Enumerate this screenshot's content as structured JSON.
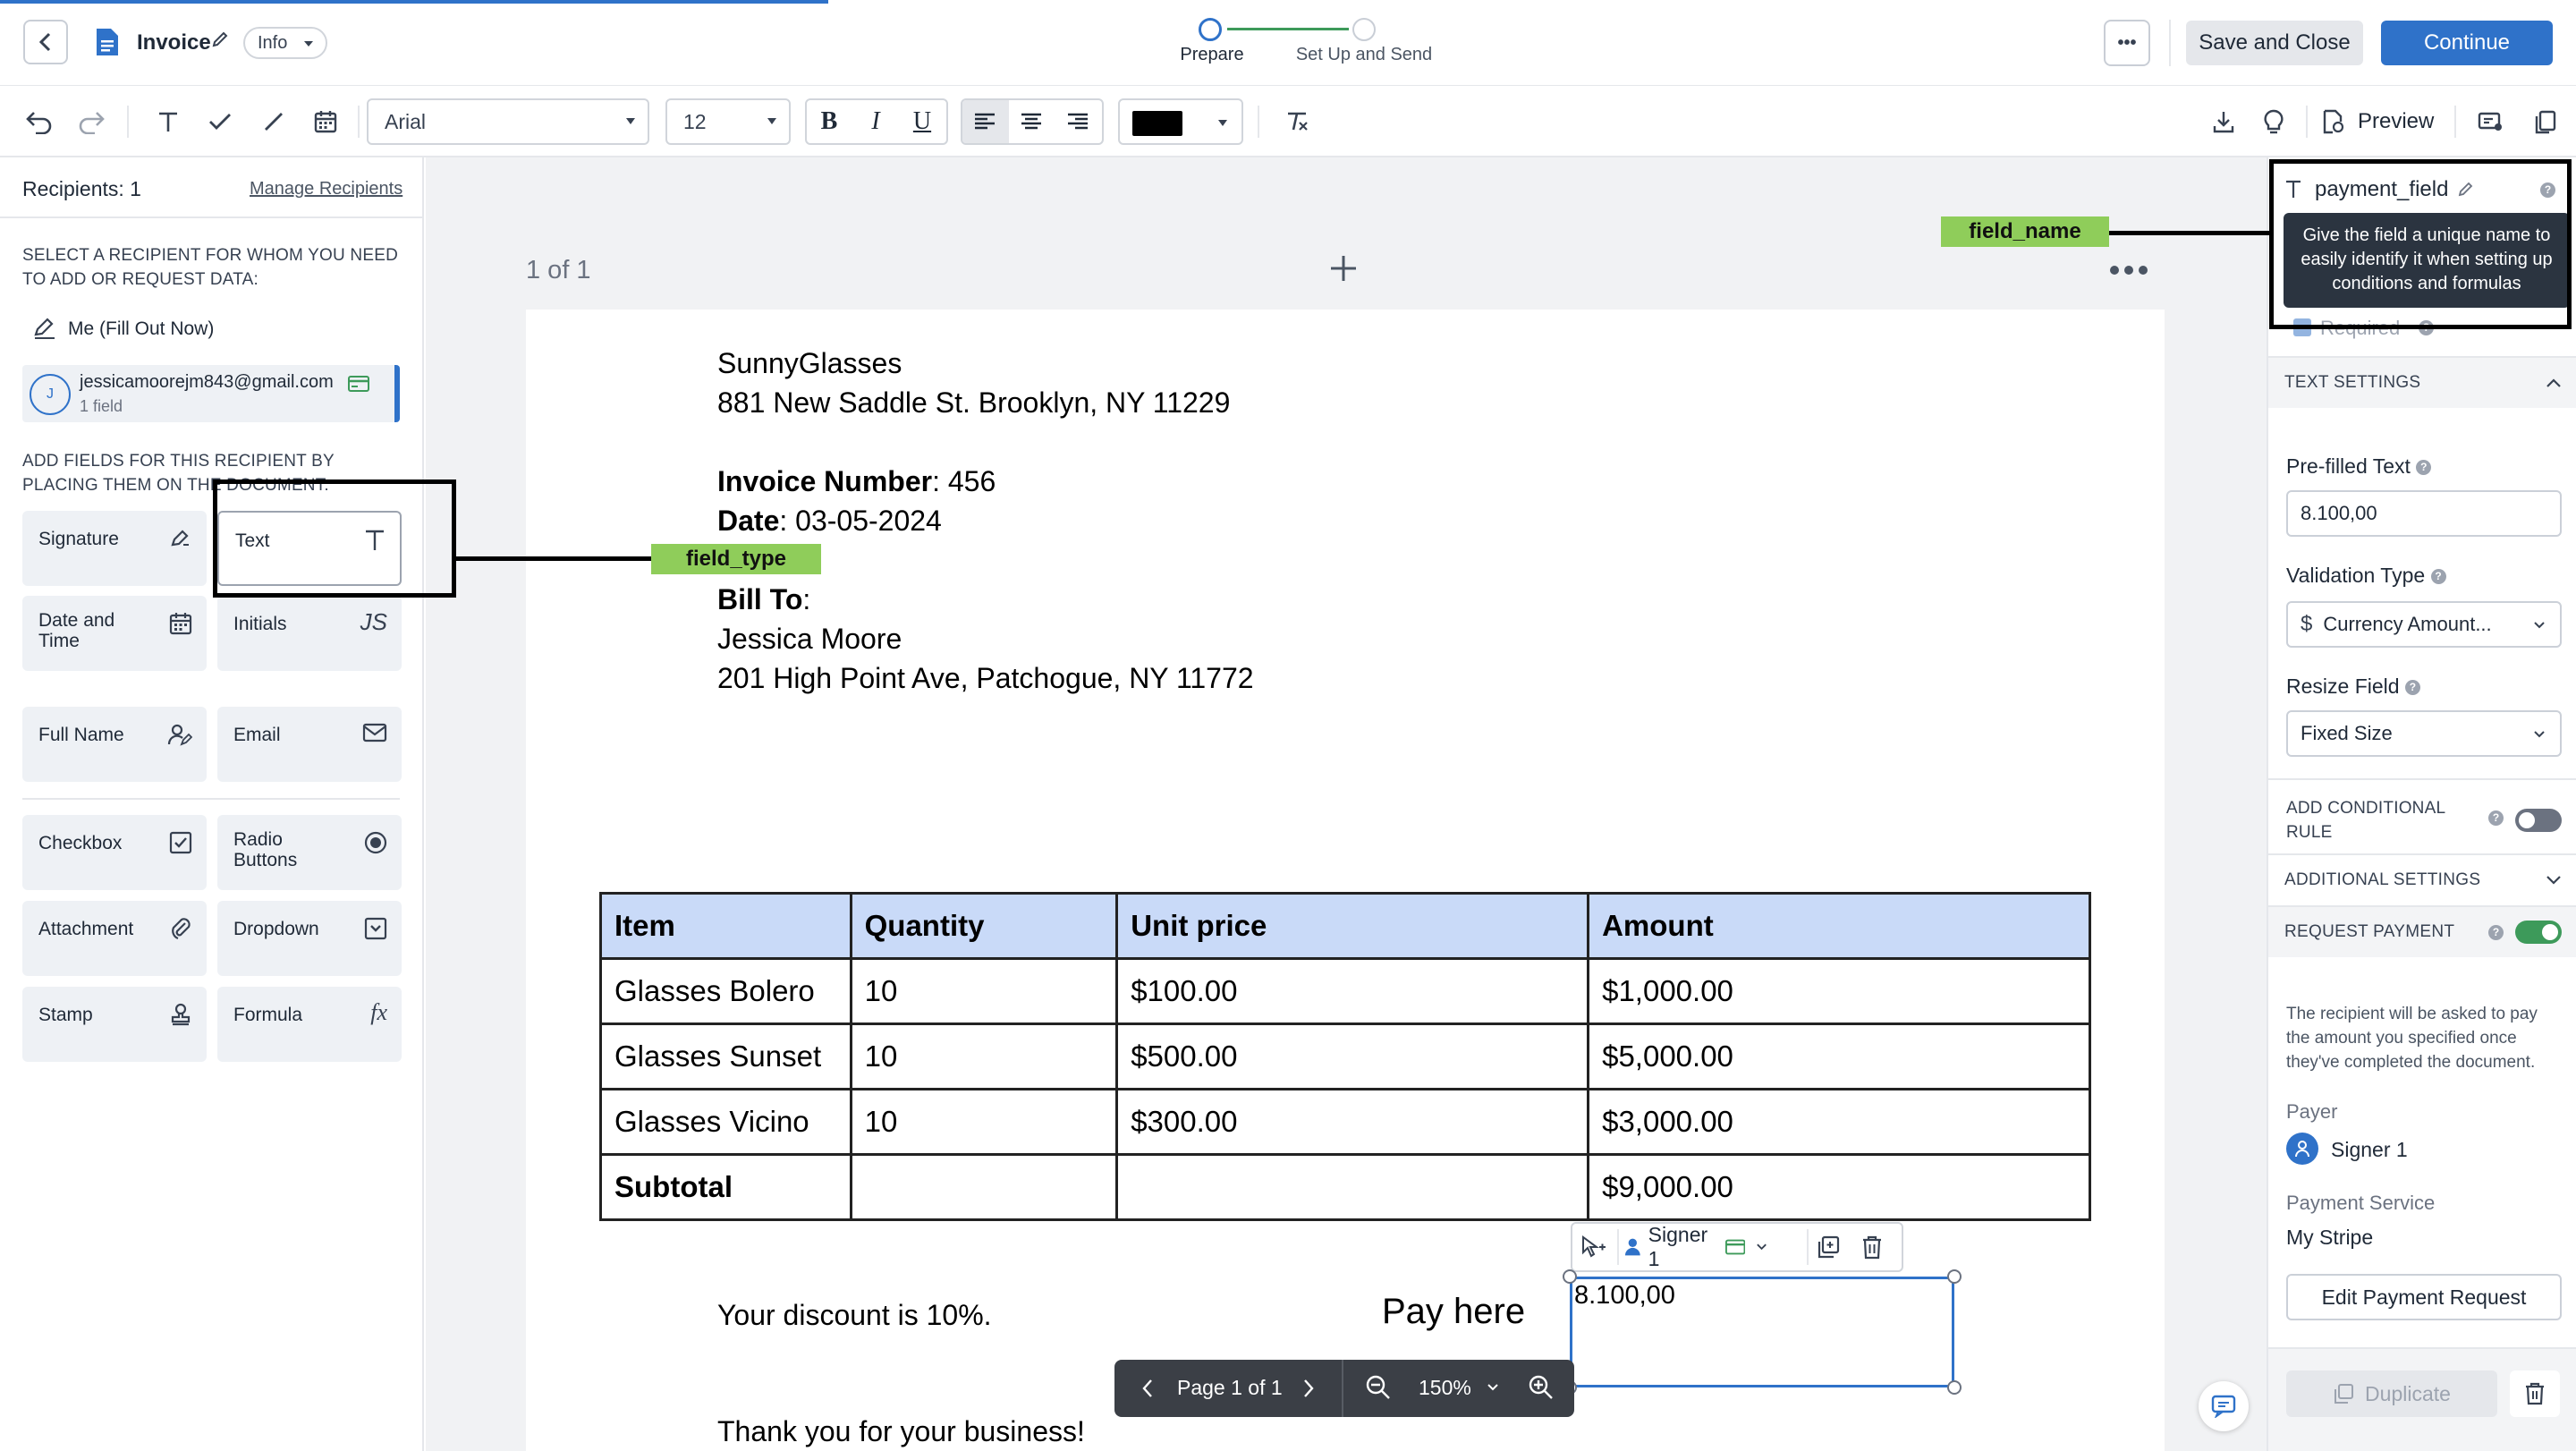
{
  "header": {
    "doc_title": "Invoice",
    "info_label": "Info",
    "steps": [
      {
        "label": "Prepare",
        "active": true
      },
      {
        "label": "Set Up and Send",
        "active": false
      }
    ],
    "more_label": "•••",
    "save_close_label": "Save and Close",
    "continue_label": "Continue"
  },
  "toolbar": {
    "font_family": "Arial",
    "font_size": "12",
    "text_color": "#000000",
    "preview_label": "Preview"
  },
  "sidebar": {
    "recipients_title": "Recipients: 1",
    "manage_label": "Manage Recipients",
    "select_prompt": "SELECT A RECIPIENT FOR WHOM YOU NEED TO ADD OR REQUEST DATA:",
    "me_label": "Me (Fill Out Now)",
    "recipient_initial": "J",
    "recipient_email": "jessicamoorejm843@gmail.com",
    "recipient_count": "1 field",
    "add_prompt": "ADD FIELDS FOR THIS RECIPIENT BY PLACING THEM ON THE DOCUMENT:",
    "fields": [
      {
        "label": "Signature",
        "icon": "pen-sign-icon"
      },
      {
        "label": "Text",
        "icon": "text-t-icon"
      },
      {
        "label": "Date and Time",
        "icon": "calendar-icon"
      },
      {
        "label": "Initials",
        "icon": "initials-icon"
      },
      {
        "label": "Full Name",
        "icon": "person-icon"
      },
      {
        "label": "Email",
        "icon": "envelope-icon"
      },
      {
        "label": "Checkbox",
        "icon": "checkbox-icon"
      },
      {
        "label": "Radio Buttons",
        "icon": "radio-icon"
      },
      {
        "label": "Attachment",
        "icon": "paperclip-icon"
      },
      {
        "label": "Dropdown",
        "icon": "dropdown-icon"
      },
      {
        "label": "Stamp",
        "icon": "stamp-icon"
      },
      {
        "label": "Formula",
        "icon": "formula-icon"
      }
    ],
    "initials_glyph": "JS",
    "formula_glyph": "fx"
  },
  "canvas": {
    "page_counter": "1 of 1",
    "bottom_bar": {
      "page_label": "Page 1 of 1",
      "zoom": "150%"
    }
  },
  "document": {
    "company": "SunnyGlasses",
    "address": "881 New Saddle St. Brooklyn, NY 11229",
    "invoice_label": "Invoice Number",
    "invoice_value": ": 456",
    "date_label": "Date",
    "date_value": ": 03-05-2024",
    "bill_to_label": "Bill To",
    "bill_to_colon": ":",
    "customer_name": "Jessica Moore",
    "customer_address": "201 High Point Ave, Patchogue, NY 11772",
    "table": {
      "headers": [
        "Item",
        "Quantity",
        "Unit price",
        "Amount"
      ],
      "rows": [
        [
          "Glasses Bolero",
          "10",
          "$100.00",
          "$1,000.00"
        ],
        [
          "Glasses Sunset",
          "10",
          "$500.00",
          "$5,000.00"
        ],
        [
          "Glasses Vicino",
          "10",
          "$300.00",
          "$3,000.00"
        ]
      ],
      "subtotal_label": "Subtotal",
      "subtotal_value": "$9,000.00"
    },
    "discount_text": "Your discount is 10%.",
    "pay_here": "Pay here",
    "thanks": "Thank you for your business!",
    "field_value": "8.100,00",
    "field_signer": "Signer 1"
  },
  "annotations": {
    "field_type": "field_type",
    "field_name": "field_name"
  },
  "right_panel": {
    "field_name": "payment_field",
    "tooltip": "Give the field a unique name to easily identify it when setting up conditions and formulas",
    "required_label": "Required",
    "text_settings": "TEXT SETTINGS",
    "prefilled_label": "Pre-filled Text",
    "prefilled_value": "8.100,00",
    "validation_label": "Validation Type",
    "validation_value": "Currency Amount...",
    "resize_label": "Resize Field",
    "resize_value": "Fixed Size",
    "conditional_label": "ADD CONDITIONAL RULE",
    "conditional_on": false,
    "additional_label": "ADDITIONAL SETTINGS",
    "request_payment_label": "REQUEST PAYMENT",
    "request_payment_on": true,
    "payment_note": "The recipient will be asked to pay the amount you specified once they've completed the document.",
    "payer_label": "Payer",
    "payer_value": "Signer 1",
    "service_label": "Payment Service",
    "service_value": "My Stripe",
    "edit_payment_label": "Edit Payment Request",
    "duplicate_label": "Duplicate"
  },
  "colors": {
    "accent": "#2f72c9",
    "toggle_on": "#3d9a5a",
    "annotation_green": "#8fcd5a",
    "table_header": "#c9daf8"
  }
}
